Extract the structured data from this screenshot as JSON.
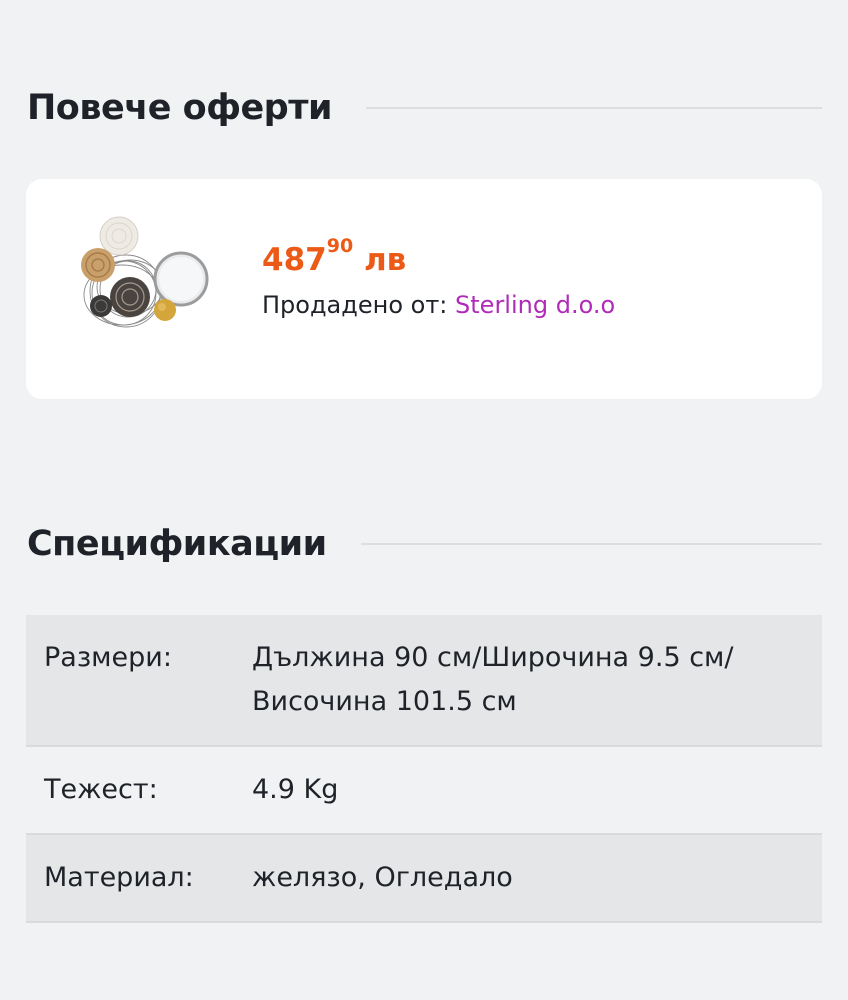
{
  "offers": {
    "title": "Повече оферти",
    "card": {
      "price_main": "487",
      "price_cents": "90",
      "price_currency": "лв",
      "seller_label": "Продадено от:",
      "seller_name": "Sterling d.o.o",
      "thumbnail": "wall-mirror-decor-image"
    }
  },
  "specs": {
    "title": "Спецификации",
    "rows": [
      {
        "key": "Размери:",
        "value": "Дължина 90 см/Широчина 9.5 см/ Височина 101.5 см"
      },
      {
        "key": "Тежест:",
        "value": "4.9 Kg"
      },
      {
        "key": "Материал:",
        "value": "желязо, Огледало"
      }
    ]
  },
  "colors": {
    "background": "#f1f2f3",
    "price": "#eb5a16",
    "seller_link": "#b02cb8",
    "row_shaded": "#e5e6e8"
  }
}
